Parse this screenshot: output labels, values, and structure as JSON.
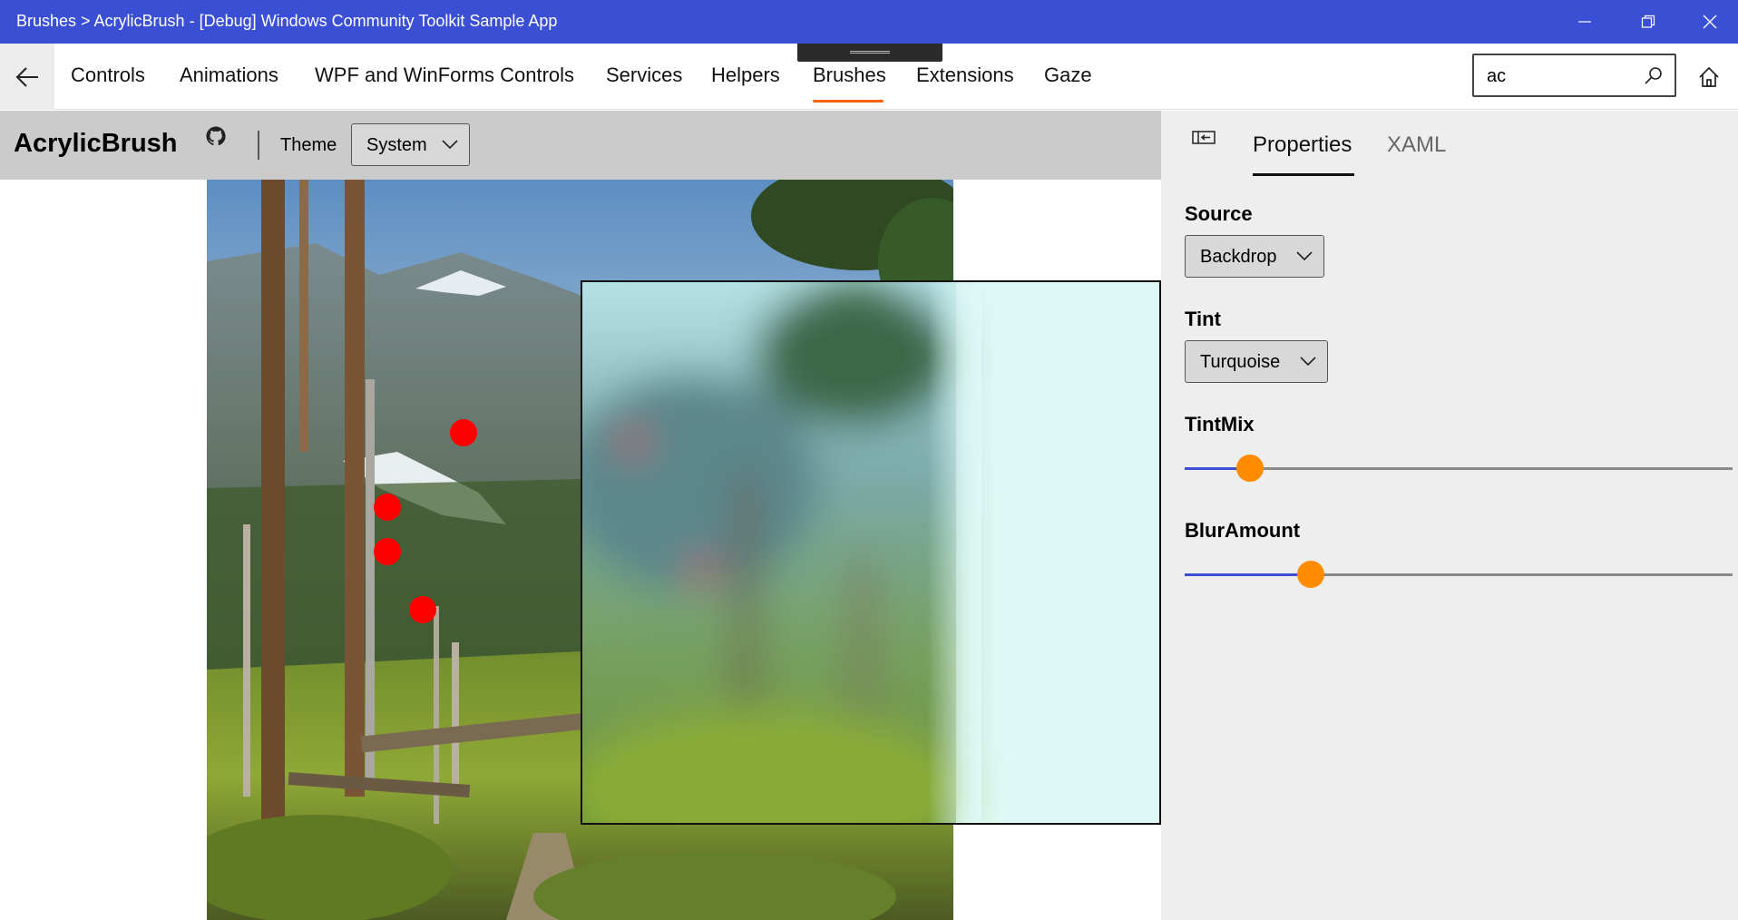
{
  "window": {
    "title": "Brushes > AcrylicBrush - [Debug] Windows Community Toolkit Sample App"
  },
  "nav": {
    "items": [
      "Controls",
      "Animations",
      "WPF and WinForms Controls",
      "Services",
      "Helpers",
      "Brushes",
      "Extensions",
      "Gaze"
    ],
    "selected": "Brushes",
    "search_value": "ac"
  },
  "sample": {
    "title": "AcrylicBrush",
    "theme_label": "Theme",
    "theme_value": "System"
  },
  "pane": {
    "tabs": [
      "Properties",
      "XAML"
    ],
    "selected_tab": "Properties",
    "source_label": "Source",
    "source_value": "Backdrop",
    "tint_label": "Tint",
    "tint_value": "Turquoise",
    "tintmix_label": "TintMix",
    "tintmix_fraction": 0.12,
    "bluramount_label": "BlurAmount",
    "bluramount_fraction": 0.23
  },
  "colors": {
    "titlebar": "#3b4fd4",
    "accent_underline": "#f7630c",
    "slider_thumb": "#ff8c00",
    "acrylic_tint": "#eafbf8",
    "dot": "#ff0000"
  },
  "icons": [
    "back-arrow-icon",
    "minimize-icon",
    "restore-icon",
    "close-icon",
    "search-icon",
    "home-icon",
    "github-icon",
    "chevron-down-icon",
    "pane-toggle-icon"
  ]
}
